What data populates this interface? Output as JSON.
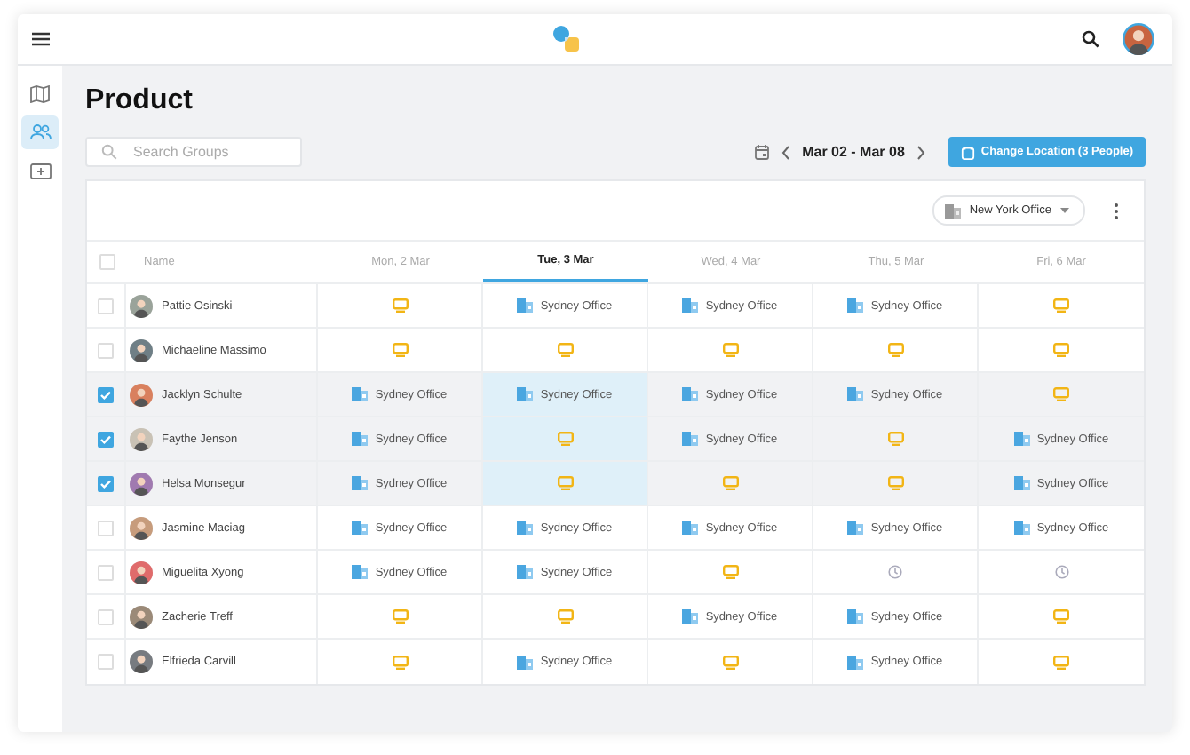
{
  "sidebar": {
    "items": [
      {
        "kind": "map",
        "selected": false
      },
      {
        "kind": "people",
        "selected": true
      },
      {
        "kind": "ticket",
        "selected": false
      }
    ]
  },
  "page_title": "Product",
  "search": {
    "placeholder": "Search Groups"
  },
  "date_range": "Mar 02 - Mar 08",
  "change_location_button": "Change Location (3 People)",
  "office_filter": "New York Office",
  "table": {
    "select_all_checked": false,
    "columns": [
      {
        "label": "Name",
        "selected": false
      },
      {
        "label": "Mon, 2 Mar",
        "selected": false
      },
      {
        "label": "Tue, 3 Mar",
        "selected": true
      },
      {
        "label": "Wed, 4 Mar",
        "selected": false
      },
      {
        "label": "Thu, 5 Mar",
        "selected": false
      },
      {
        "label": "Fri, 6 Mar",
        "selected": false
      }
    ],
    "rows": [
      {
        "checked": false,
        "cells": [
          {
            "kind": "person",
            "label": "Pattie Osinski"
          },
          {
            "kind": "remote"
          },
          {
            "kind": "office",
            "label": "Sydney Office"
          },
          {
            "kind": "office",
            "label": "Sydney Office"
          },
          {
            "kind": "office",
            "label": "Sydney Office"
          },
          {
            "kind": "remote"
          }
        ]
      },
      {
        "checked": false,
        "cells": [
          {
            "kind": "person",
            "label": "Michaeline Massimo"
          },
          {
            "kind": "remote"
          },
          {
            "kind": "remote"
          },
          {
            "kind": "remote"
          },
          {
            "kind": "remote"
          },
          {
            "kind": "remote"
          }
        ]
      },
      {
        "checked": true,
        "cells": [
          {
            "kind": "person",
            "label": "Jacklyn Schulte"
          },
          {
            "kind": "office",
            "label": "Sydney Office"
          },
          {
            "kind": "office",
            "label": "Sydney Office"
          },
          {
            "kind": "office",
            "label": "Sydney Office"
          },
          {
            "kind": "office",
            "label": "Sydney Office"
          },
          {
            "kind": "remote"
          }
        ]
      },
      {
        "checked": true,
        "cells": [
          {
            "kind": "person",
            "label": "Faythe Jenson"
          },
          {
            "kind": "office",
            "label": "Sydney Office"
          },
          {
            "kind": "remote"
          },
          {
            "kind": "office",
            "label": "Sydney Office"
          },
          {
            "kind": "remote"
          },
          {
            "kind": "office",
            "label": "Sydney Office"
          }
        ]
      },
      {
        "checked": true,
        "cells": [
          {
            "kind": "person",
            "label": "Helsa Monsegur"
          },
          {
            "kind": "office",
            "label": "Sydney Office"
          },
          {
            "kind": "remote"
          },
          {
            "kind": "remote"
          },
          {
            "kind": "remote"
          },
          {
            "kind": "office",
            "label": "Sydney Office"
          }
        ]
      },
      {
        "checked": false,
        "cells": [
          {
            "kind": "person",
            "label": "Jasmine Maciag"
          },
          {
            "kind": "office",
            "label": "Sydney Office"
          },
          {
            "kind": "office",
            "label": "Sydney Office"
          },
          {
            "kind": "office",
            "label": "Sydney Office"
          },
          {
            "kind": "office",
            "label": "Sydney Office"
          },
          {
            "kind": "office",
            "label": "Sydney Office"
          }
        ]
      },
      {
        "checked": false,
        "cells": [
          {
            "kind": "person",
            "label": "Miguelita Xyong"
          },
          {
            "kind": "office",
            "label": "Sydney Office"
          },
          {
            "kind": "office",
            "label": "Sydney Office"
          },
          {
            "kind": "remote"
          },
          {
            "kind": "away"
          },
          {
            "kind": "away"
          }
        ]
      },
      {
        "checked": false,
        "cells": [
          {
            "kind": "person",
            "label": "Zacherie Treff"
          },
          {
            "kind": "remote"
          },
          {
            "kind": "remote"
          },
          {
            "kind": "office",
            "label": "Sydney Office"
          },
          {
            "kind": "office",
            "label": "Sydney Office"
          },
          {
            "kind": "remote"
          }
        ]
      },
      {
        "checked": false,
        "cells": [
          {
            "kind": "person",
            "label": "Elfrieda Carvill"
          },
          {
            "kind": "remote"
          },
          {
            "kind": "office",
            "label": "Sydney Office"
          },
          {
            "kind": "remote"
          },
          {
            "kind": "office",
            "label": "Sydney Office"
          },
          {
            "kind": "remote"
          }
        ]
      }
    ]
  }
}
